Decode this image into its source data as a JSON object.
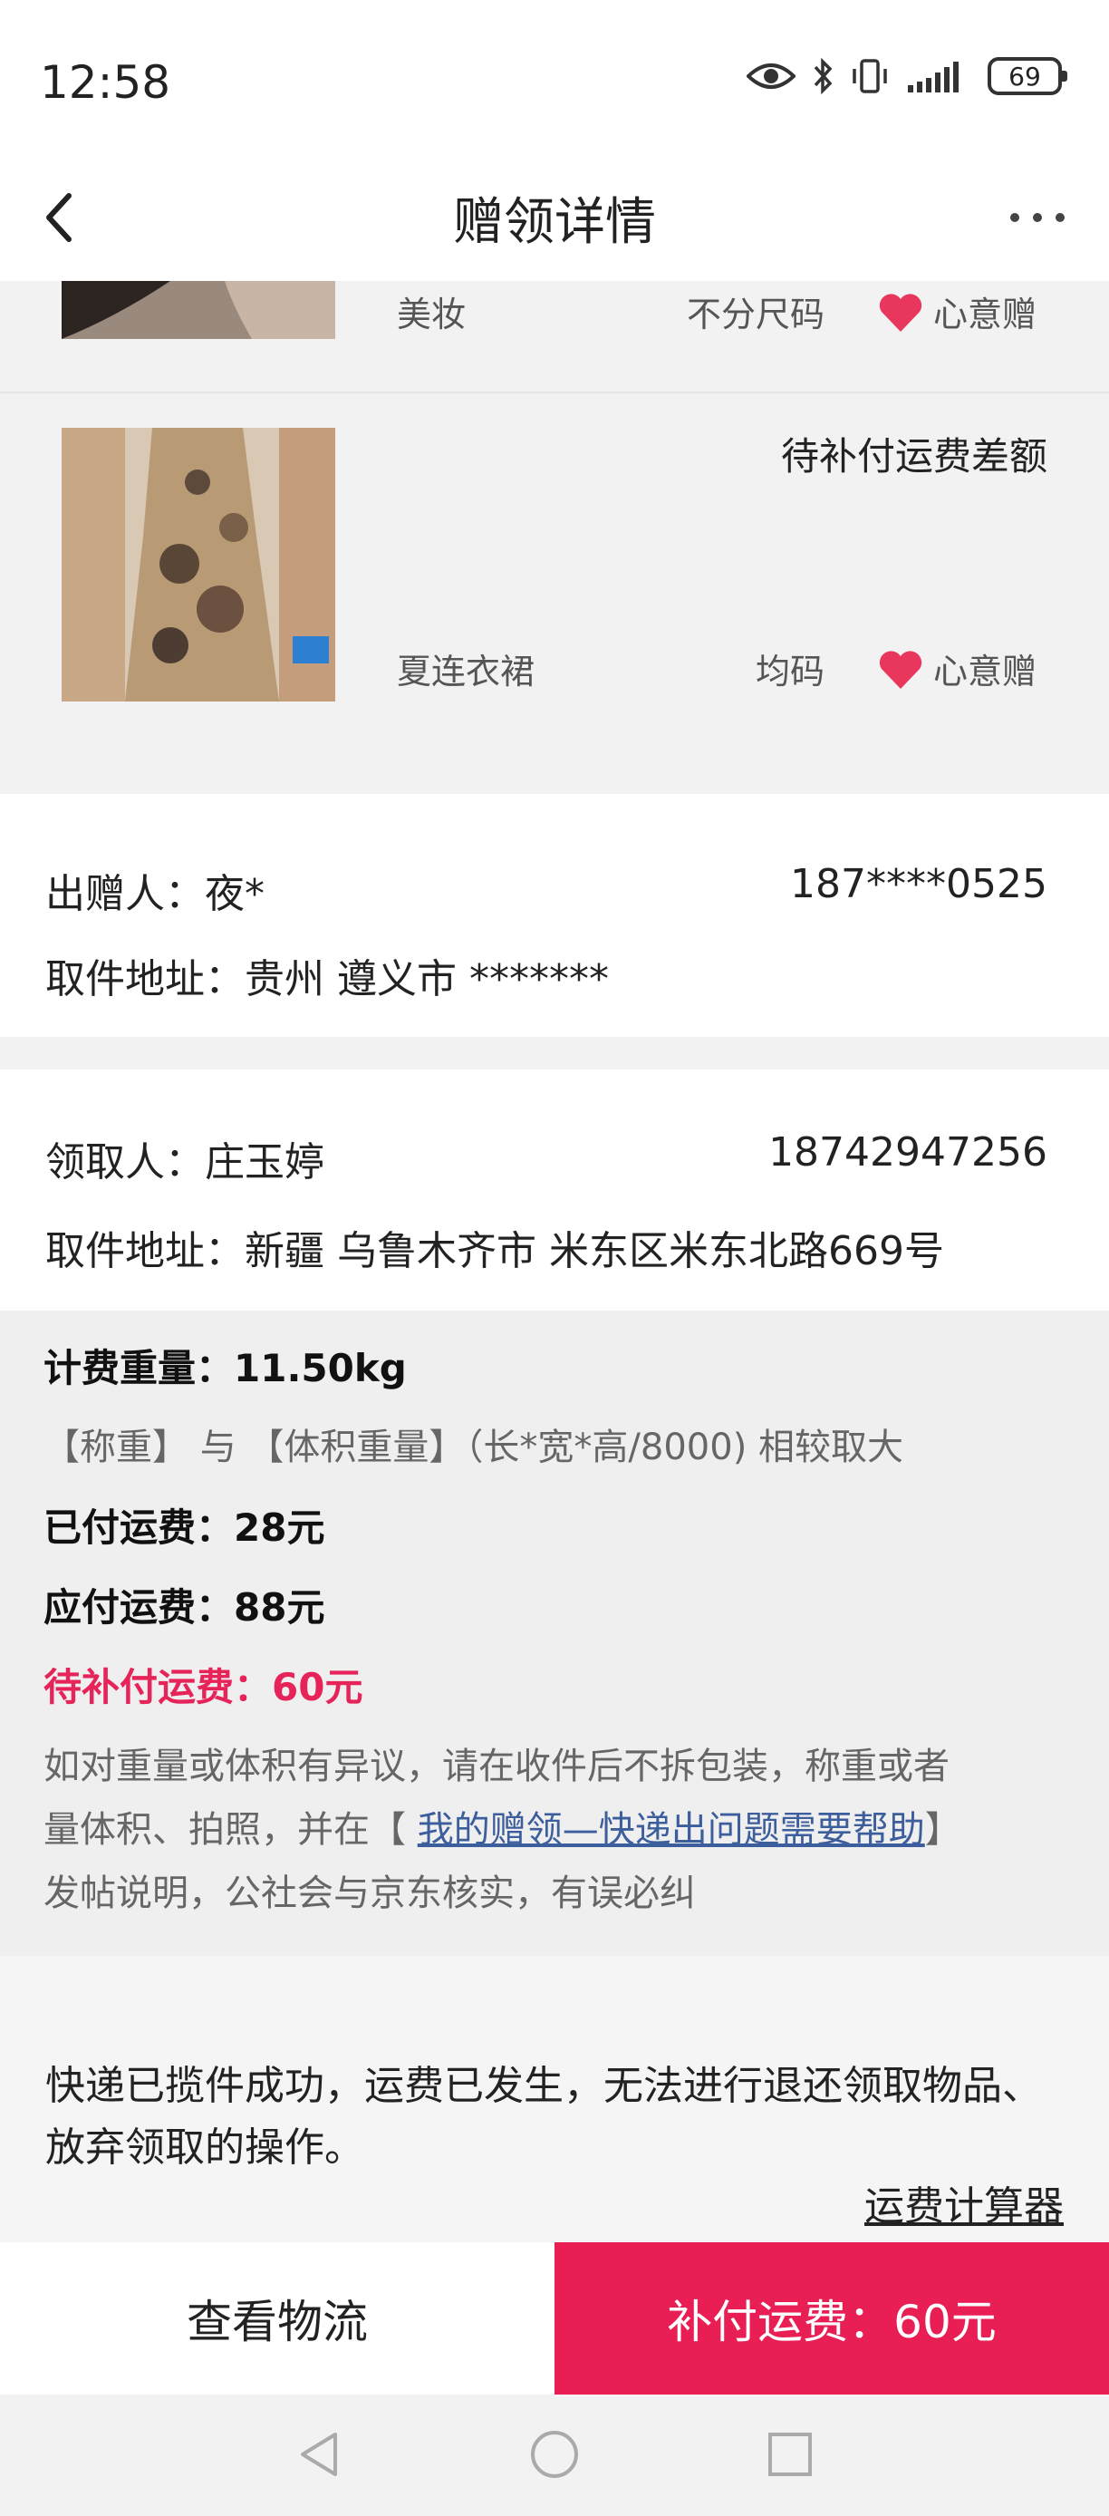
{
  "status": {
    "time": "12:58",
    "battery": "69"
  },
  "nav": {
    "title": "赠领详情"
  },
  "items": [
    {
      "name": "美妆",
      "size": "不分尺码",
      "gift_type": "心意赠",
      "status": ""
    },
    {
      "name": "夏连衣裙",
      "size": "均码",
      "gift_type": "心意赠",
      "status": "待补付运费差额"
    }
  ],
  "sender": {
    "label": "出赠人：",
    "name": "夜*",
    "phone": "187****0525",
    "address_label": "取件地址：",
    "address": "贵州 遵义市 *******"
  },
  "receiver": {
    "label": "领取人：",
    "name": "庄玉婷",
    "phone": "18742947256",
    "address_label": "取件地址：",
    "address": "新疆 乌鲁木齐市 米东区米东北路669号"
  },
  "fee": {
    "weight_label": "计费重量：",
    "weight": "11.50kg",
    "formula": "【称重】 与 【体积重量】（长*宽*高/8000) 相较取大",
    "paid_label": "已付运费：",
    "paid": "28元",
    "due_label": "应付运费：",
    "due": "88元",
    "pending_label": "待补付运费：",
    "pending": "60元",
    "dispute_1": "如对重量或体积有异议，请在收件后不拆包装，称重或者",
    "dispute_2_pre": "量体积、拍照，并在【 ",
    "dispute_link": "我的赠领—快递出问题需要帮助",
    "dispute_2_post": "】",
    "dispute_3": "发帖说明，公社会与京东核实，有误必纠"
  },
  "notice": {
    "text": "快递已揽件成功，运费已发生，无法进行退还领取物品、放弃领取的操作。",
    "calculator": "运费计算器"
  },
  "actions": {
    "track": "查看物流",
    "pay": "补付运费：60元"
  },
  "colors": {
    "accent": "#e81e55",
    "link": "#3d5e9c",
    "heart": "#e8365d"
  }
}
